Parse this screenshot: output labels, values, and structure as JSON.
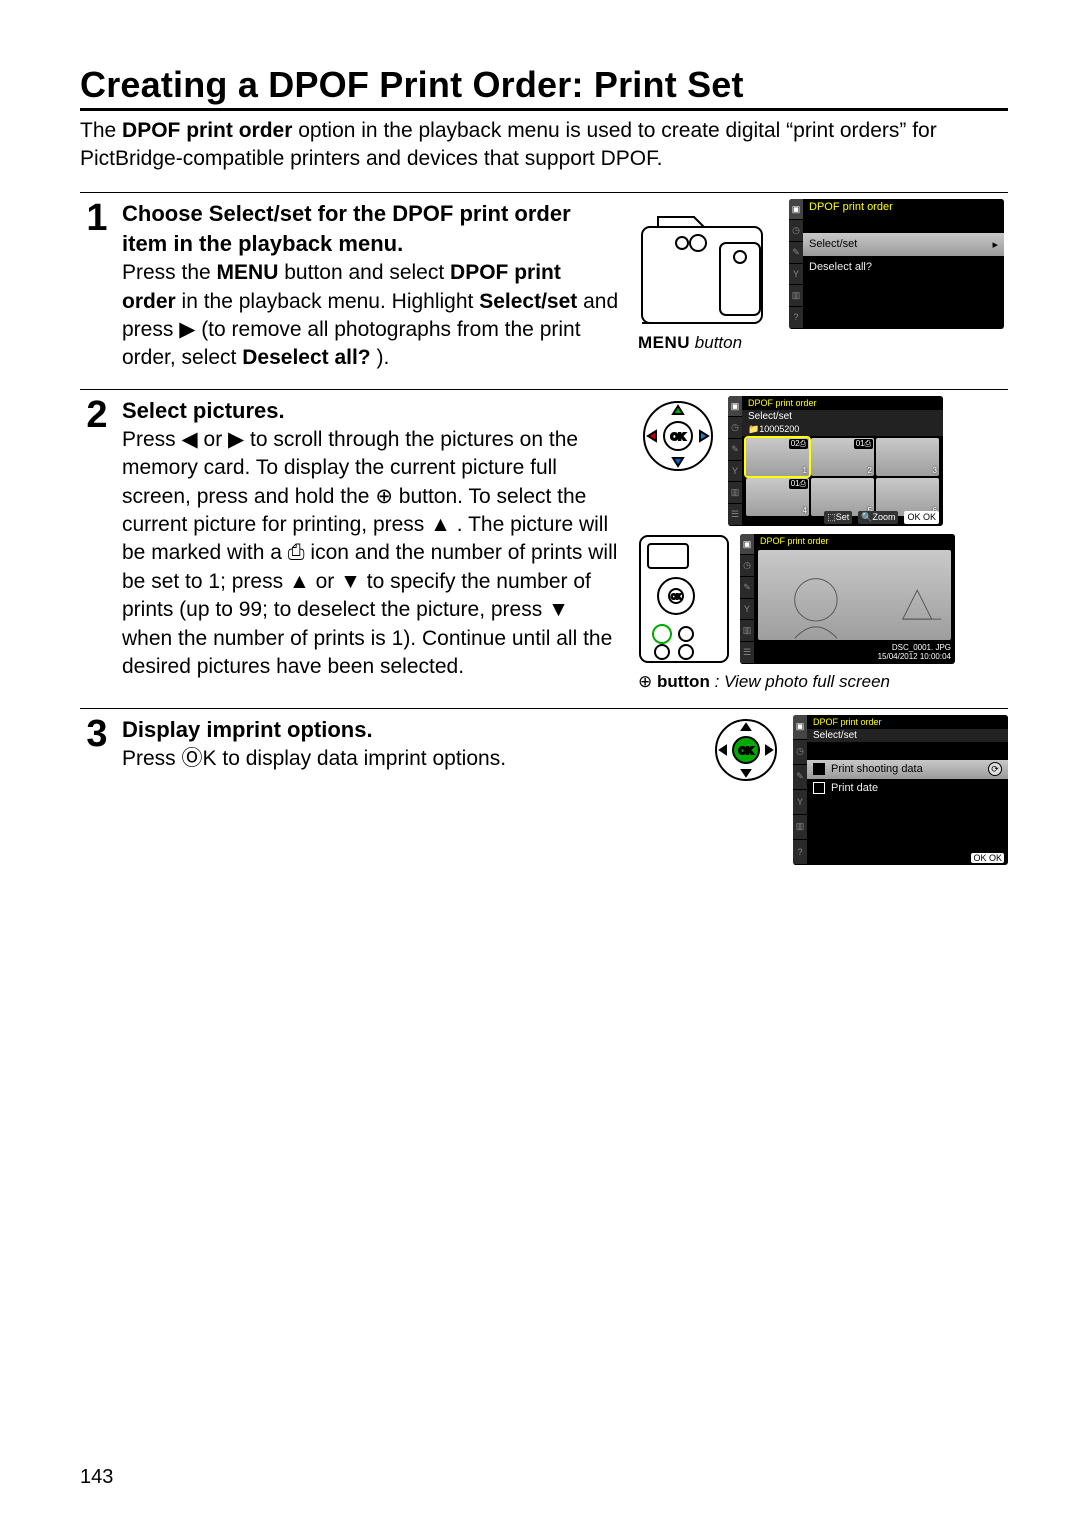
{
  "title": "Creating a DPOF Print Order: Print Set",
  "intro": {
    "pre": "The ",
    "bold": "DPOF print order",
    "post": " option in the playback menu is used to create digital “print orders” for PictBridge-compatible printers and devices that support DPOF."
  },
  "steps": [
    {
      "num": "1",
      "heading": [
        "Choose ",
        "Select/set",
        " for the ",
        "DPOF print order",
        " item in the playback menu."
      ],
      "body": [
        "Press the ",
        "MENU",
        " button and select ",
        "DPOF print order",
        " in the playback menu.  Highlight ",
        "Select/set",
        " and press ",
        "▶",
        " (to remove all photographs from the print order, select ",
        "Deselect all?",
        ")."
      ],
      "lcd": {
        "title": "DPOF print order",
        "rows": [
          "Select/set",
          "Deselect all?"
        ]
      },
      "caption": [
        "MENU",
        " button"
      ]
    },
    {
      "num": "2",
      "heading": "Select pictures.",
      "body": [
        "Press ",
        "◀",
        " or ",
        "▶",
        " to scroll through the pictures on the memory card.  To display the current picture full screen, press and hold the ",
        "⊕",
        " button.  To select the current picture for printing, press ",
        "▲",
        ".  The picture will be marked with a ",
        "⎙",
        " icon and the number of prints will be set to 1; press ",
        "▲",
        " or ",
        "▼",
        " to specify the number of prints (up to 99; to deselect the picture, press ",
        "▼",
        " when the number of prints is 1).  Continue until all the desired pictures have been selected."
      ],
      "lcdA": {
        "title": "DPOF print order",
        "sub": "Select/set",
        "folder": "📁10005200",
        "badges": [
          "02⎙",
          "01⎙",
          "01⎙"
        ],
        "footer": [
          "⬚Set",
          "🔍Zoom",
          "OK OK"
        ]
      },
      "lcdB": {
        "title": "DPOF print order",
        "meta": [
          "DSC_0001. JPG",
          "15/04/2012   10:00:04"
        ]
      },
      "caption": [
        "⊕ ",
        "button",
        ": View photo full screen"
      ]
    },
    {
      "num": "3",
      "heading": "Display imprint options.",
      "body": [
        "Press ",
        "ⓄK",
        " to display data imprint options."
      ],
      "lcd": {
        "title": "DPOF print order",
        "sub": "Select/set",
        "options": [
          "Print shooting data",
          "Print date"
        ],
        "footer": "OK OK"
      }
    }
  ],
  "page_number": "143"
}
